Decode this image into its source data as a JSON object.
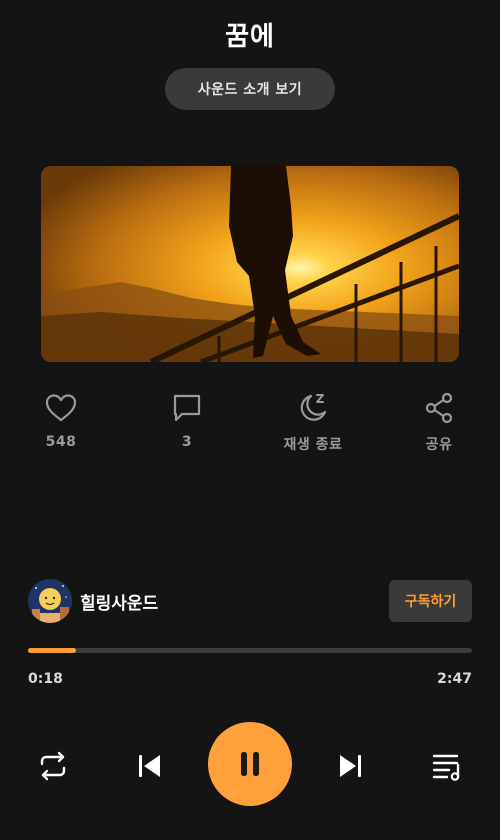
{
  "header": {
    "title": "꿈에",
    "intro_button": "사운드 소개 보기"
  },
  "actions": [
    {
      "icon": "heart-icon",
      "label": "548"
    },
    {
      "icon": "comment-icon",
      "label": "3"
    },
    {
      "icon": "moon-sleep-icon",
      "label": "재생 종료"
    },
    {
      "icon": "share-icon",
      "label": "공유"
    }
  ],
  "channel": {
    "name": "힐링사운드",
    "subscribe_label": "구독하기"
  },
  "player": {
    "elapsed": "0:18",
    "total": "2:47",
    "progress_fraction": 0.108
  },
  "colors": {
    "background": "#141414",
    "accent": "#ff9d33",
    "button_bg": "#3a3a3a",
    "secondary_text": "#9a9a9a"
  }
}
